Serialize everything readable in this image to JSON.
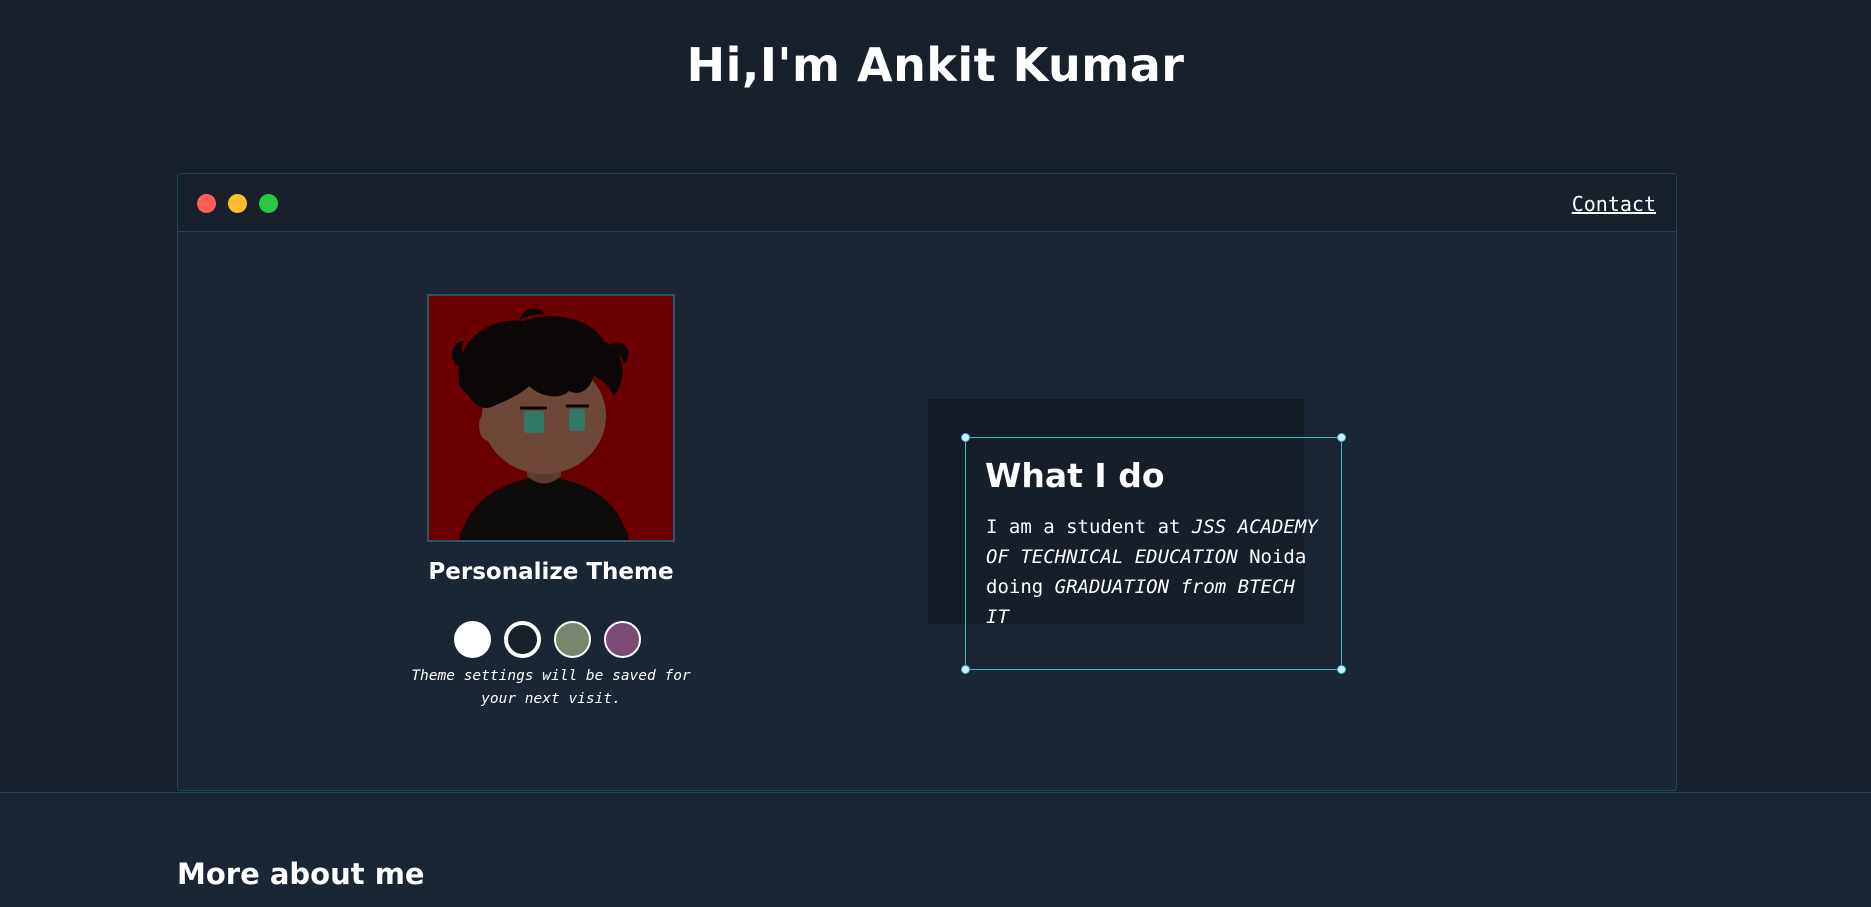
{
  "header": {
    "title": "Hi,I'm Ankit Kumar"
  },
  "window": {
    "contact_label": "Contact"
  },
  "profile": {
    "avatar_alt": "avatar",
    "personalize_title": "Personalize Theme",
    "theme_swatches": [
      {
        "name": "light",
        "color": "#ffffff"
      },
      {
        "name": "dark",
        "color": "#17202b"
      },
      {
        "name": "green",
        "color": "#78866b"
      },
      {
        "name": "purple",
        "color": "#7b4b73"
      }
    ],
    "theme_note": "Theme settings will be saved for your next visit."
  },
  "what_i_do": {
    "title": "What I do",
    "text_plain_1": "I am a student at ",
    "text_italic_1": "JSS ACADEMY OF TECHNICAL EDUCATION",
    "text_plain_2": " Noida doing ",
    "text_italic_2": "GRADUATION from BTECH IT"
  },
  "more_about": {
    "title": "More about me"
  },
  "colors": {
    "background": "#17202b",
    "window_bg": "#1a2633",
    "border": "#1f4656",
    "accent": "#3fb6c9",
    "avatar_bg": "#6b0000"
  }
}
